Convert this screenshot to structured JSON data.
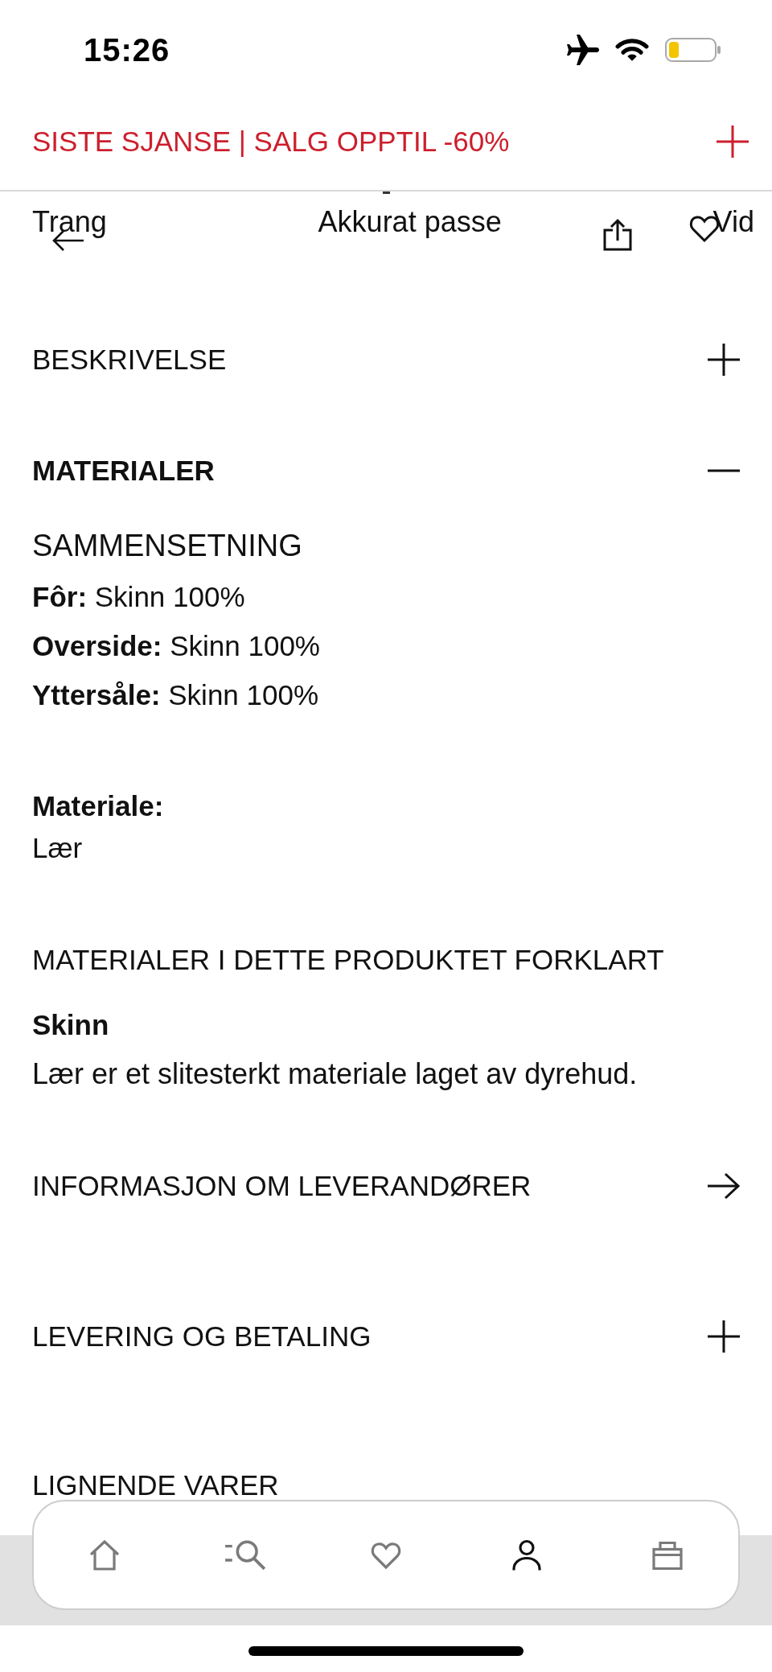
{
  "status_bar": {
    "time": "15:26"
  },
  "promo_banner": {
    "text": "SISTE SJANSE | SALG OPPTIL -60%"
  },
  "fit_scale": {
    "labels": [
      "Trang",
      "Akkurat passe",
      "Vid"
    ]
  },
  "sections": [
    {
      "kind": "accordion",
      "title": "BESKRIVELSE",
      "expanded": false
    },
    {
      "kind": "accordion",
      "title": "MATERIALER",
      "expanded": true,
      "content": {
        "composition_title": "SAMMENSETNING",
        "composition": [
          "**Fôr:** Skinn 100%",
          "**Overside:** Skinn 100%",
          "**Yttersåle:** Skinn 100%"
        ],
        "material_label": "Materiale:",
        "material_value": "Lær",
        "explained_title": "MATERIALER I DETTE PRODUKTET FORKLART",
        "explained": [
          {
            "name": "Skinn",
            "description": "Lær er et slitesterkt materiale laget av dyrehud."
          }
        ]
      }
    },
    {
      "kind": "link",
      "title": "INFORMASJON OM LEVERANDØRER"
    },
    {
      "kind": "accordion",
      "title": "LEVERING OG BETALING",
      "expanded": false
    },
    {
      "kind": "heading",
      "title": "LIGNENDE VARER"
    }
  ],
  "tab_bar": {
    "items": [
      {
        "selected": false
      },
      {
        "selected": false
      },
      {
        "selected": false
      },
      {
        "selected": true
      },
      {
        "selected": false
      }
    ]
  }
}
